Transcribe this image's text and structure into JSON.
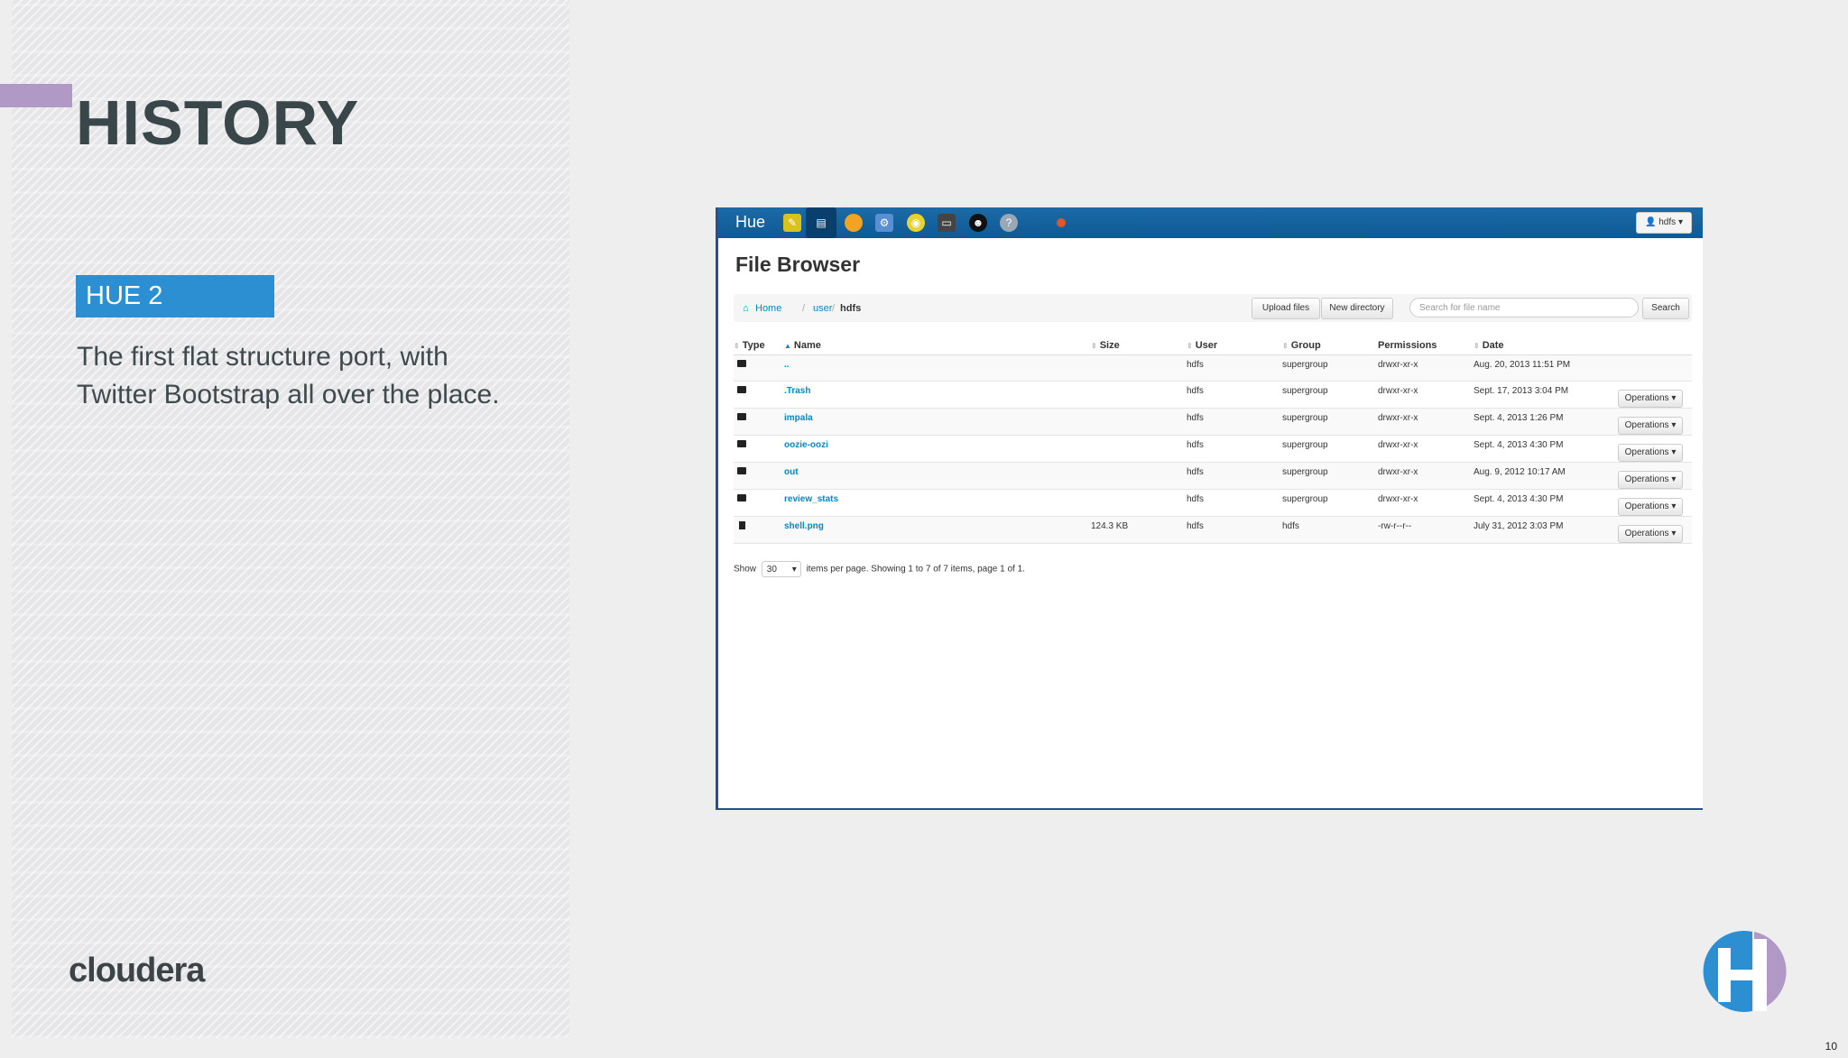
{
  "slide": {
    "title": "HISTORY",
    "subtitle": "HUE 2",
    "body": "The first flat structure port, with Twitter Bootstrap all over the place.",
    "logo": "cloudera",
    "page_number": "10",
    "colors": {
      "accent": "#b199c6",
      "subtitle_bg": "#2b8fd2",
      "title": "#39474a"
    }
  },
  "hue": {
    "brand": "Hue",
    "user_menu": "hdfs",
    "page_title": "File Browser",
    "breadcrumb": {
      "home": "Home",
      "user": "user",
      "current": "hdfs"
    },
    "buttons": {
      "upload": "Upload files",
      "new_dir": "New directory",
      "search": "Search"
    },
    "search_placeholder": "Search for file name",
    "columns": [
      "Type",
      "Name",
      "Size",
      "User",
      "Group",
      "Permissions",
      "Date"
    ],
    "rows": [
      {
        "type": "folder",
        "name": "..",
        "size": "",
        "user": "hdfs",
        "group": "supergroup",
        "perm": "drwxr-xr-x",
        "date": "Aug. 20, 2013 11:51 PM",
        "ops": ""
      },
      {
        "type": "folder",
        "name": ".Trash",
        "size": "",
        "user": "hdfs",
        "group": "supergroup",
        "perm": "drwxr-xr-x",
        "date": "Sept. 17, 2013 3:04 PM",
        "ops": "Operations"
      },
      {
        "type": "folder",
        "name": "impala",
        "size": "",
        "user": "hdfs",
        "group": "supergroup",
        "perm": "drwxr-xr-x",
        "date": "Sept. 4, 2013 1:26 PM",
        "ops": "Operations"
      },
      {
        "type": "folder",
        "name": "oozie-oozi",
        "size": "",
        "user": "hdfs",
        "group": "supergroup",
        "perm": "drwxr-xr-x",
        "date": "Sept. 4, 2013 4:30 PM",
        "ops": "Operations"
      },
      {
        "type": "folder",
        "name": "out",
        "size": "",
        "user": "hdfs",
        "group": "supergroup",
        "perm": "drwxr-xr-x",
        "date": "Aug. 9, 2012 10:17 AM",
        "ops": "Operations"
      },
      {
        "type": "folder",
        "name": "review_stats",
        "size": "",
        "user": "hdfs",
        "group": "supergroup",
        "perm": "drwxr-xr-x",
        "date": "Sept. 4, 2013 4:30 PM",
        "ops": "Operations"
      },
      {
        "type": "file",
        "name": "shell.png",
        "size": "124.3 KB",
        "user": "hdfs",
        "group": "hdfs",
        "perm": "-rw-r--r--",
        "date": "July 31, 2012 3:03 PM",
        "ops": "Operations"
      }
    ],
    "pager": {
      "show": "Show",
      "per_page": "30",
      "summary": "items per page. Showing 1 to 7 of 7 items, page 1 of 1."
    },
    "nav_icons": [
      "beeswax-icon",
      "filebrowser-icon",
      "pig-icon",
      "jobdesigner-icon",
      "oozie-icon",
      "shell-icon",
      "useradmin-icon",
      "help-icon",
      "status-icon"
    ]
  }
}
